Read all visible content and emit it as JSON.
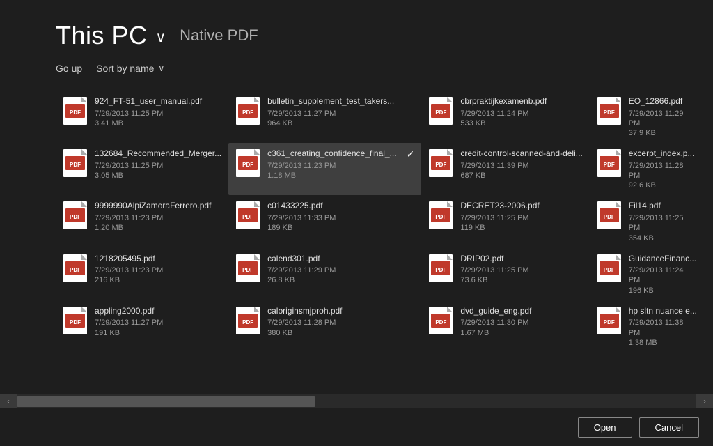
{
  "header": {
    "title": "This PC",
    "subtitle": "Native PDF",
    "chevron": "∨"
  },
  "toolbar": {
    "go_up": "Go up",
    "sort_label": "Sort by name",
    "sort_chevron": "∨"
  },
  "files": [
    {
      "name": "924_FT-51_user_manual.pdf",
      "date": "7/29/2013 11:25 PM",
      "size": "3.41 MB",
      "selected": false
    },
    {
      "name": "bulletin_supplement_test_takers...",
      "date": "7/29/2013 11:27 PM",
      "size": "964 KB",
      "selected": false
    },
    {
      "name": "cbrpraktijkexamenb.pdf",
      "date": "7/29/2013 11:24 PM",
      "size": "533 KB",
      "selected": false
    },
    {
      "name": "EO_12866.pdf",
      "date": "7/29/2013 11:29 PM",
      "size": "37.9 KB",
      "selected": false
    },
    {
      "name": "132684_Recommended_Merger...",
      "date": "7/29/2013 11:25 PM",
      "size": "3.05 MB",
      "selected": false
    },
    {
      "name": "c361_creating_confidence_final_...",
      "date": "7/29/2013 11:23 PM",
      "size": "1.18 MB",
      "selected": true,
      "checked": true
    },
    {
      "name": "credit-control-scanned-and-deli...",
      "date": "7/29/2013 11:39 PM",
      "size": "687 KB",
      "selected": false
    },
    {
      "name": "excerpt_index.p...",
      "date": "7/29/2013 11:28 PM",
      "size": "92.6 KB",
      "selected": false,
      "truncated": true
    },
    {
      "name": "9999990AlpiZamoraFerrero.pdf",
      "date": "7/29/2013 11:23 PM",
      "size": "1.20 MB",
      "selected": false
    },
    {
      "name": "c01433225.pdf",
      "date": "7/29/2013 11:33 PM",
      "size": "189 KB",
      "selected": false
    },
    {
      "name": "DECRET23-2006.pdf",
      "date": "7/29/2013 11:25 PM",
      "size": "119 KB",
      "selected": false
    },
    {
      "name": "Fil14.pdf",
      "date": "7/29/2013 11:25 PM",
      "size": "354 KB",
      "selected": false
    },
    {
      "name": "1218205495.pdf",
      "date": "7/29/2013 11:23 PM",
      "size": "216 KB",
      "selected": false
    },
    {
      "name": "calend301.pdf",
      "date": "7/29/2013 11:29 PM",
      "size": "26.8 KB",
      "selected": false
    },
    {
      "name": "DRIP02.pdf",
      "date": "7/29/2013 11:25 PM",
      "size": "73.6 KB",
      "selected": false
    },
    {
      "name": "GuidanceFinanc...",
      "date": "7/29/2013 11:24 PM",
      "size": "196 KB",
      "selected": false,
      "truncated": true
    },
    {
      "name": "appling2000.pdf",
      "date": "7/29/2013 11:27 PM",
      "size": "191 KB",
      "selected": false
    },
    {
      "name": "caloriginsmjproh.pdf",
      "date": "7/29/2013 11:28 PM",
      "size": "380 KB",
      "selected": false
    },
    {
      "name": "dvd_guide_eng.pdf",
      "date": "7/29/2013 11:30 PM",
      "size": "1.67 MB",
      "selected": false
    },
    {
      "name": "hp sltn nuance e...",
      "date": "7/29/2013 11:38 PM",
      "size": "1.38 MB",
      "selected": false,
      "truncated": true
    }
  ],
  "buttons": {
    "open": "Open",
    "cancel": "Cancel"
  }
}
